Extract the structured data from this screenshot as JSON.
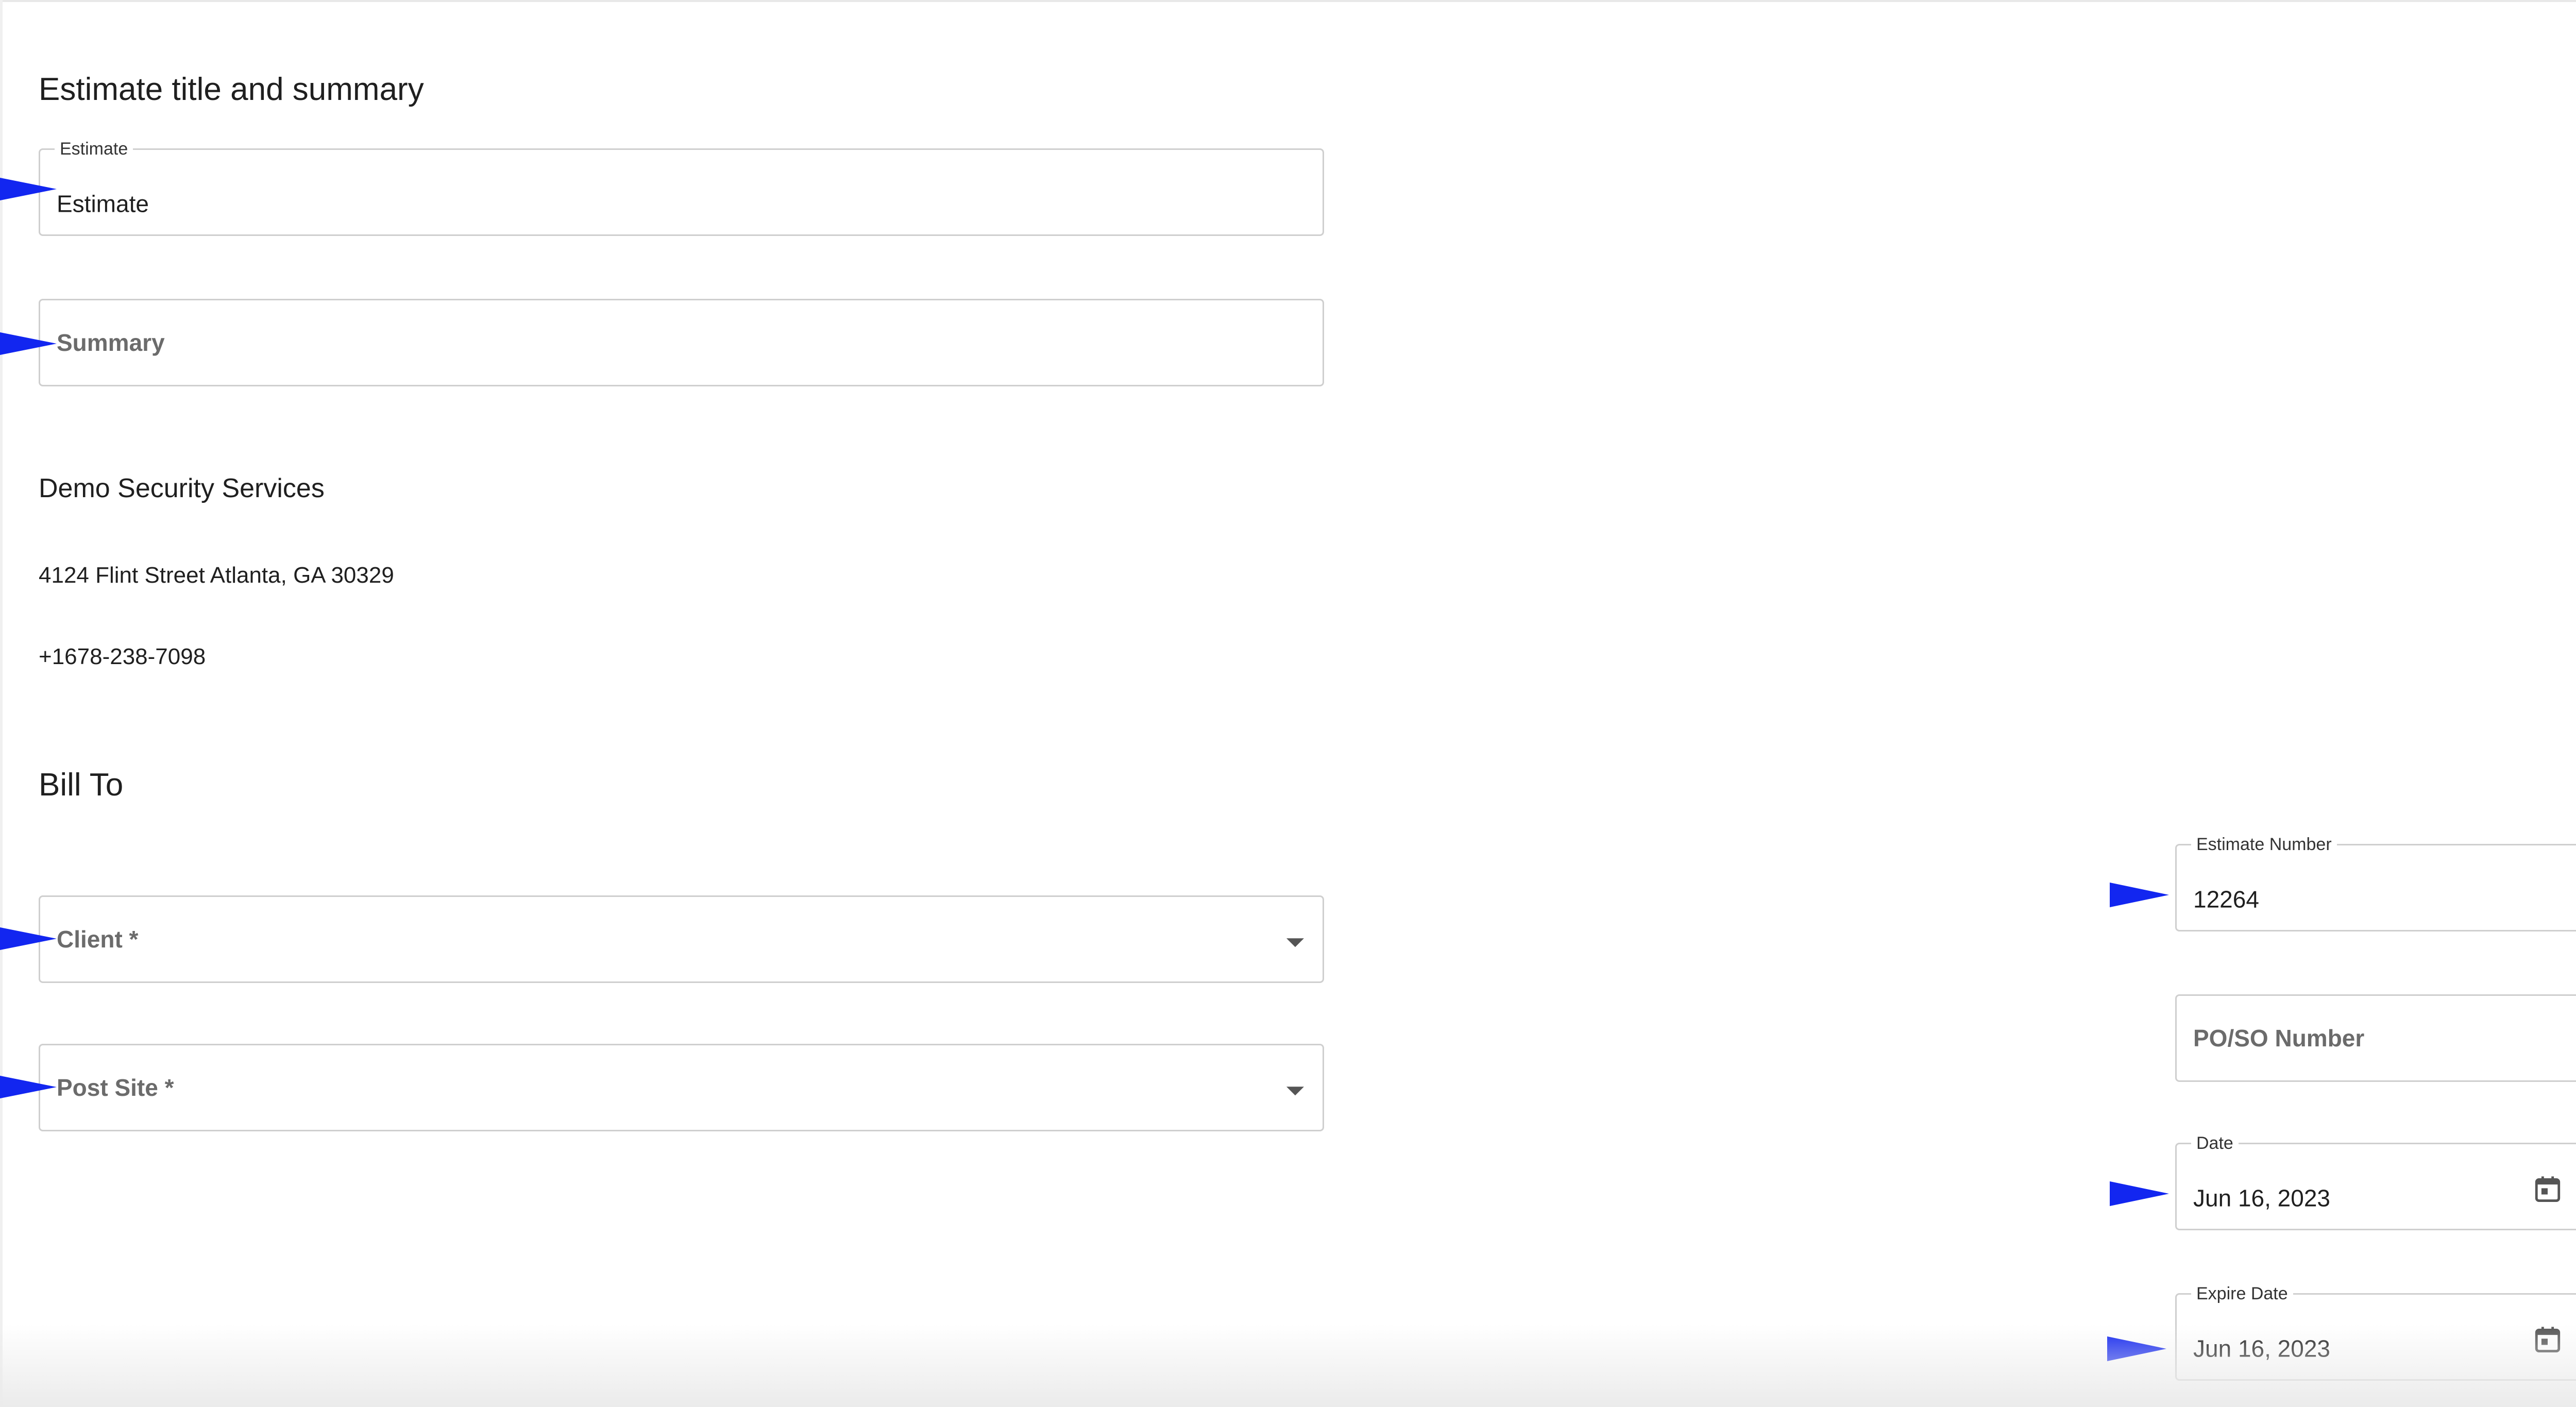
{
  "section_title": "Estimate title and summary",
  "estimate_field": {
    "label": "Estimate",
    "value": "Estimate"
  },
  "summary_field": {
    "placeholder": "Summary"
  },
  "company": {
    "name": "Demo Security Services",
    "address": "4124 Flint Street Atlanta, GA 30329",
    "phone": "+1678-238-7098"
  },
  "bill_to": {
    "title": "Bill To",
    "client_placeholder": "Client *",
    "post_site_placeholder": "Post Site *"
  },
  "estimate_number": {
    "label": "Estimate Number",
    "value": "12264"
  },
  "po_so_number": {
    "placeholder": "PO/SO Number"
  },
  "date": {
    "label": "Date",
    "value": "Jun 16, 2023"
  },
  "expire_date": {
    "label": "Expire Date",
    "value": "Jun 16, 2023"
  },
  "icons": {
    "dropdown": "chevron-down-icon",
    "calendar": "calendar-icon",
    "annotation_pointer": "arrow-pointer-icon"
  },
  "colors": {
    "pointer": "#1226f0",
    "field_border": "#cfcfcf",
    "text": "#1f1f1f",
    "placeholder": "#6b6b6b"
  }
}
